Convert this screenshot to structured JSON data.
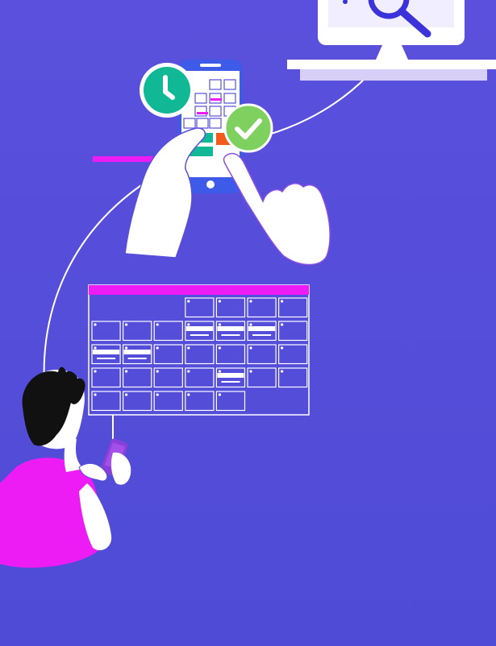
{
  "colors": {
    "background": "#574fdb",
    "background_bottom": "#4f4bd6",
    "accent_magenta": "#ee1cf4",
    "teal": "#10b895",
    "green_check": "#7ed05f",
    "phone_blue": "#3d5ae8",
    "orange_tile": "#f25b1c",
    "monitor_screen": "#f1efff",
    "white": "#ffffff",
    "lavender": "#d8cff8",
    "hair": "#111111"
  },
  "icons": {
    "search": "magnifier-icon",
    "clock": "clock-icon",
    "check": "check-icon",
    "pointer": "pointing-hand-icon"
  },
  "calendar": {
    "rows": 5,
    "cols": 7,
    "filled_cells": [
      2,
      3,
      4,
      5,
      6
    ]
  }
}
